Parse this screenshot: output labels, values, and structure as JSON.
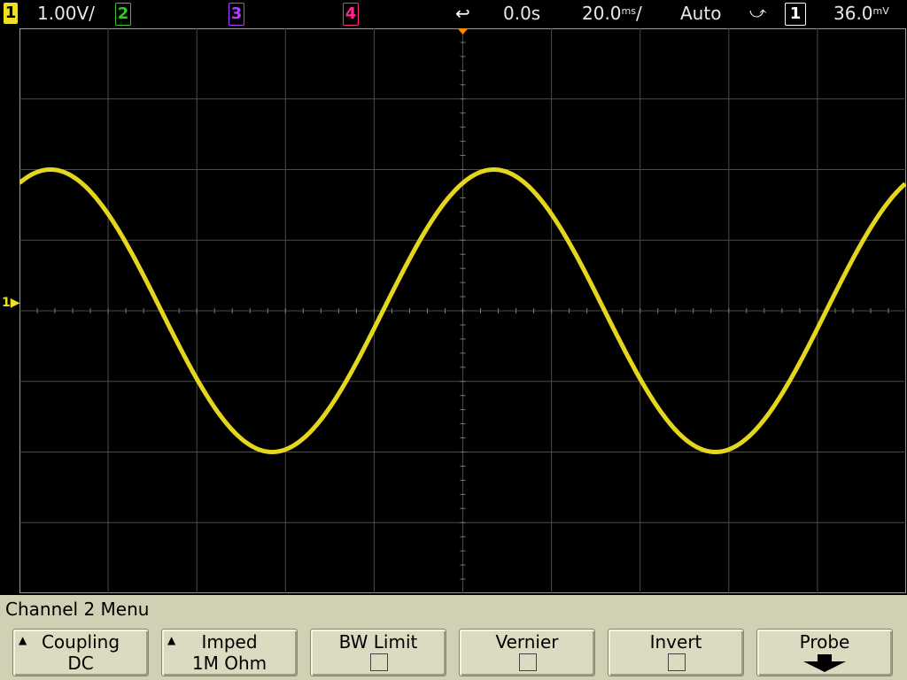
{
  "topbar": {
    "ch1_num": "1",
    "ch1_scale": "1.00V/",
    "ch2_num": "2",
    "ch3_num": "3",
    "ch4_num": "4",
    "time_delay": "0.0s",
    "timebase": "20.0",
    "timebase_unit": "ms",
    "mode": "Auto",
    "trig_source": "1",
    "trig_level": "36.0",
    "trig_level_unit": "mV"
  },
  "colors": {
    "ch1": "#f0e020",
    "ch2": "#36c828",
    "ch3": "#b040ff",
    "ch4": "#ff2a8c",
    "grid": "#4a4a4a",
    "trigger_marker": "#ff8a00"
  },
  "trace": {
    "channel": "1",
    "waveform": "sine",
    "peak_divisions": 2,
    "period_divisions": 5,
    "phase_at_left": 0.18
  },
  "menu": {
    "title": "Channel 2  Menu",
    "softkeys": [
      {
        "label": "Coupling",
        "value": "DC",
        "arrow": true
      },
      {
        "label": "Imped",
        "value": "1M Ohm",
        "arrow": true
      },
      {
        "label": "BW Limit",
        "checkbox": false
      },
      {
        "label": "Vernier",
        "checkbox": false
      },
      {
        "label": "Invert",
        "checkbox": false
      },
      {
        "label": "Probe",
        "submenu": true
      }
    ]
  }
}
